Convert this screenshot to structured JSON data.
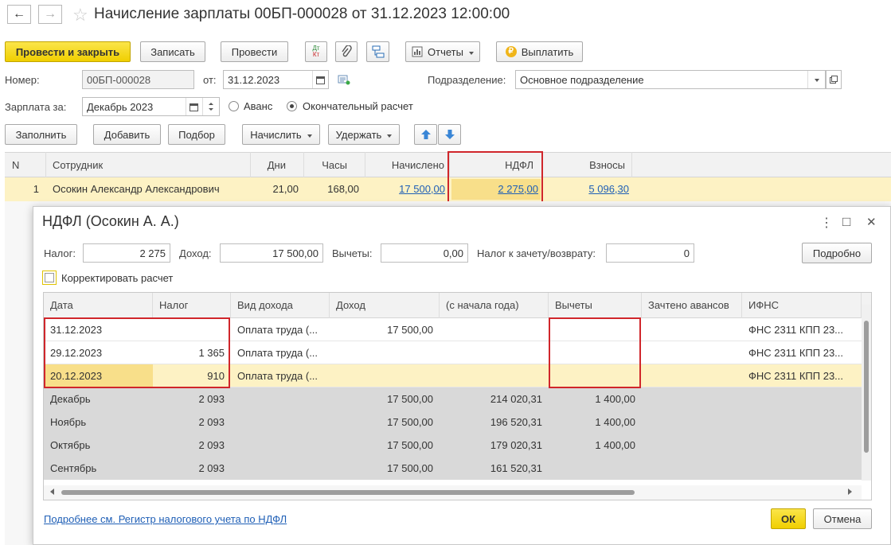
{
  "doc": {
    "title": "Начисление зарплаты 00БП-000028 от 31.12.2023 12:00:00",
    "back_icon": "←",
    "forward_icon": "→",
    "star_icon": "☆",
    "toolbar": {
      "post_close": "Провести и закрыть",
      "save": "Записать",
      "post": "Провести",
      "reports": "Отчеты",
      "pay": "Выплатить"
    },
    "number_label": "Номер:",
    "number_value": "00БП-000028",
    "date_label": "от:",
    "date_value": "31.12.2023",
    "division_label": "Подразделение:",
    "division_value": "Основное подразделение",
    "salary_for_label": "Зарплата за:",
    "salary_for_value": "Декабрь 2023",
    "advance_label": "Аванс",
    "final_label": "Окончательный расчет",
    "actions": {
      "fill": "Заполнить",
      "add": "Добавить",
      "pick": "Подбор",
      "accrue": "Начислить",
      "withhold": "Удержать"
    },
    "columns": [
      "N",
      "Сотрудник",
      "Дни",
      "Часы",
      "Начислено",
      "НДФЛ",
      "Взносы"
    ],
    "row": {
      "n": "1",
      "employee": "Осокин Александр Александрович",
      "days": "21,00",
      "hours": "168,00",
      "accrued": "17 500,00",
      "ndfl": "2 275,00",
      "contrib": "5 096,30"
    }
  },
  "dialog": {
    "title": "НДФЛ (Осокин А. А.)",
    "tax_label": "Налог:",
    "tax_value": "2 275",
    "income_label": "Доход:",
    "income_value": "17 500,00",
    "deductions_label": "Вычеты:",
    "deductions_value": "0,00",
    "offset_label": "Налог к зачету/возврату:",
    "offset_value": "0",
    "details_button": "Подробно",
    "correct_label": "Корректировать расчет",
    "columns": [
      "Дата",
      "Налог",
      "Вид дохода",
      "Доход",
      "(с начала года)",
      "Вычеты",
      "Зачтено авансов",
      "ИФНС"
    ],
    "rows": [
      [
        "31.12.2023",
        "",
        "Оплата труда (...",
        "17 500,00",
        "",
        "",
        "",
        "ФНС 2311 КПП 23..."
      ],
      [
        "29.12.2023",
        "1 365",
        "Оплата труда (...",
        "",
        "",
        "",
        "",
        "ФНС 2311 КПП 23..."
      ],
      [
        "20.12.2023",
        "910",
        "Оплата труда (...",
        "",
        "",
        "",
        "",
        "ФНС 2311 КПП 23..."
      ],
      [
        "Декабрь",
        "2 093",
        "",
        "17 500,00",
        "214 020,31",
        "1 400,00",
        "",
        ""
      ],
      [
        "Ноябрь",
        "2 093",
        "",
        "17 500,00",
        "196 520,31",
        "1 400,00",
        "",
        ""
      ],
      [
        "Октябрь",
        "2 093",
        "",
        "17 500,00",
        "179 020,31",
        "1 400,00",
        "",
        ""
      ],
      [
        "Сентябрь",
        "2 093",
        "",
        "17 500,00",
        "161 520,31",
        "",
        "",
        ""
      ]
    ],
    "footer_link": "Подробнее см. Регистр налогового учета по НДФЛ",
    "ok": "ОК",
    "cancel": "Отмена",
    "more_icon": "⋮",
    "maximize_icon": "□",
    "close_icon": "✕"
  },
  "colors": {
    "accent": "#f5d800",
    "highlight": "#fdf2c4",
    "selected": "#f8df8a",
    "red_box": "#d0262b",
    "link": "#1f5fb6",
    "grey_row": "#d9d9d9"
  }
}
